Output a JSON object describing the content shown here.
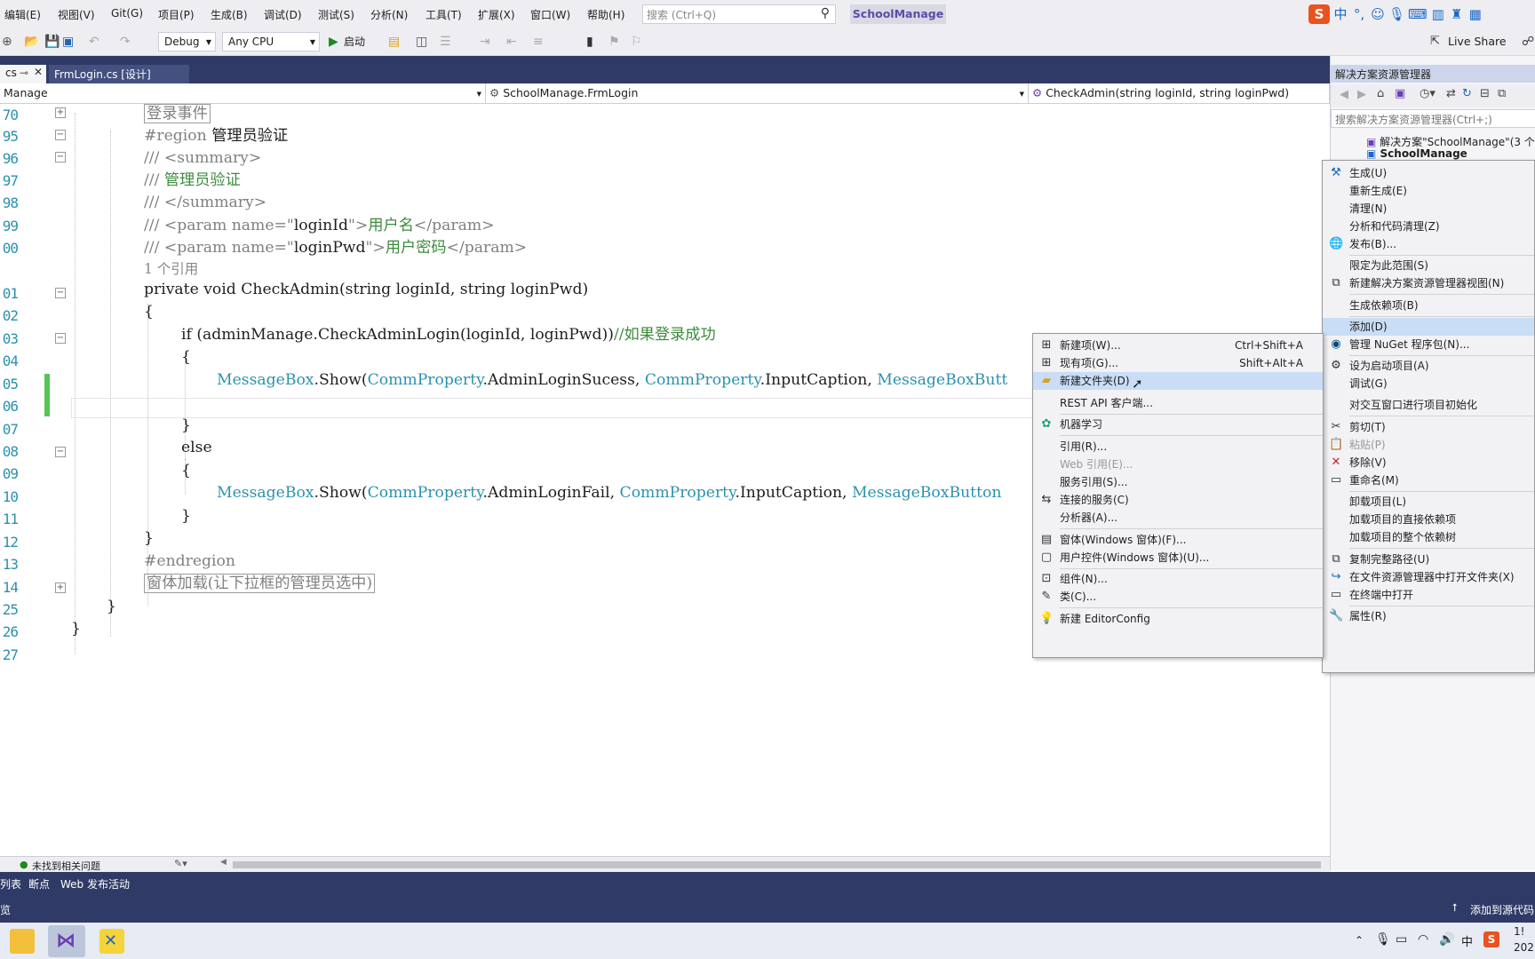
{
  "menus": [
    "编辑(E)",
    "视图(V)",
    "Git(G)",
    "项目(P)",
    "生成(B)",
    "调试(D)",
    "测试(S)",
    "分析(N)",
    "工具(T)",
    "扩展(X)",
    "窗口(W)",
    "帮助(H)"
  ],
  "search": {
    "placeholder": "搜索 (Ctrl+Q)"
  },
  "project_name": "SchoolManage",
  "ime": {
    "lang": "中",
    "punct": "°,"
  },
  "toolbar": {
    "config": "Debug",
    "platform": "Any CPU",
    "start": "启动",
    "live_share": "Live Share"
  },
  "tabs": {
    "prev": "cs",
    "active": "FrmLogin.cs [设计]"
  },
  "nav": {
    "project": "Manage",
    "class": "SchoolManage.FrmLogin",
    "member": "CheckAdmin(string loginId, string loginPwd)"
  },
  "line_numbers": [
    "70",
    "95",
    "96",
    "97",
    "98",
    "99",
    "00",
    "",
    "01",
    "02",
    "03",
    "04",
    "05",
    "06",
    "07",
    "08",
    "09",
    "10",
    "11",
    "12",
    "13",
    "14",
    "25",
    "26",
    "27"
  ],
  "code": {
    "region_collapsed": "登录事件",
    "region_kw": "#region",
    "region_name": "管理员验证",
    "doc1": "/// <summary>",
    "doc2_prefix": "/// ",
    "doc2": "管理员验证",
    "doc3": "/// </summary>",
    "doc4a": "/// <param name=\"",
    "doc4b": "loginId",
    "doc4c": "\">",
    "doc4d": "用户名",
    "doc4e": "</param>",
    "doc5b": "loginPwd",
    "doc5d": "用户密码",
    "refs": "1 个引用",
    "sig_a": "private void CheckAdmin(",
    "sig_b": "string",
    "sig_c": " loginId, ",
    "sig_d": " loginPwd)",
    "brace_open": "{",
    "brace_close": "}",
    "if_a": "if (adminManage.CheckAdminLogin(loginId, loginPwd))",
    "if_cmt": "//如果登录成功",
    "mb_a": "MessageBox",
    "mb_b": ".Show(",
    "mb_c": "CommProperty",
    "mb_d": ".AdminLoginSucess, ",
    "mb_e": ".InputCaption, ",
    "mb_f": "MessageBoxButt",
    "else_kw": "else",
    "mb2_d": ".AdminLoginFail, ",
    "mb2_f": "MessageBoxButton",
    "endregion": "#endregion",
    "region2": "窗体加载(让下拉框的管理员选中)"
  },
  "editor_status": {
    "issues": "未找到相关问题"
  },
  "solution": {
    "title": "解决方案资源管理器",
    "search_placeholder": "搜索解决方案资源管理器(Ctrl+;)",
    "root": "解决方案\"SchoolManage\"(3 个项目",
    "project": "SchoolManage"
  },
  "project_menu": [
    {
      "label": "生成(U)",
      "icon": "build-icon"
    },
    {
      "label": "重新生成(E)"
    },
    {
      "label": "清理(N)"
    },
    {
      "label": "分析和代码清理(Z)"
    },
    {
      "label": "发布(B)...",
      "icon": "publish-icon"
    },
    {
      "label": "限定为此范围(S)"
    },
    {
      "label": "新建解决方案资源管理器视图(N)",
      "icon": "new-view-icon"
    },
    {
      "label": "生成依赖项(B)"
    },
    {
      "label": "添加(D)"
    },
    {
      "label": "管理 NuGet 程序包(N)...",
      "icon": "nuget-icon"
    },
    {
      "label": "设为启动项目(A)",
      "icon": "gear-icon"
    },
    {
      "label": "调试(G)"
    },
    {
      "label": "对交互窗口进行项目初始化"
    },
    {
      "label": "剪切(T)",
      "icon": "cut-icon"
    },
    {
      "label": "粘贴(P)",
      "icon": "paste-icon",
      "disabled": true
    },
    {
      "label": "移除(V)",
      "icon": "remove-icon"
    },
    {
      "label": "重命名(M)",
      "icon": "rename-icon"
    },
    {
      "label": "卸载项目(L)"
    },
    {
      "label": "加载项目的直接依赖项"
    },
    {
      "label": "加载项目的整个依赖树"
    },
    {
      "label": "复制完整路径(U)",
      "icon": "copy-icon"
    },
    {
      "label": "在文件资源管理器中打开文件夹(X)",
      "icon": "open-folder-icon"
    },
    {
      "label": "在终端中打开",
      "icon": "terminal-icon"
    },
    {
      "label": "属性(R)",
      "icon": "wrench-icon"
    }
  ],
  "add_menu": [
    {
      "label": "新建项(W)...",
      "shortcut": "Ctrl+Shift+A",
      "icon": "new-item-icon"
    },
    {
      "label": "现有项(G)...",
      "shortcut": "Shift+Alt+A",
      "icon": "existing-item-icon"
    },
    {
      "label": "新建文件夹(D)",
      "icon": "folder-icon"
    },
    {
      "label": "REST API 客户端..."
    },
    {
      "label": "机器学习",
      "icon": "ml-icon"
    },
    {
      "label": "引用(R)..."
    },
    {
      "label": "Web 引用(E)...",
      "disabled": true
    },
    {
      "label": "服务引用(S)..."
    },
    {
      "label": "连接的服务(C)",
      "icon": "connected-service-icon"
    },
    {
      "label": "分析器(A)..."
    },
    {
      "label": "窗体(Windows 窗体)(F)...",
      "icon": "form-icon"
    },
    {
      "label": "用户控件(Windows 窗体)(U)...",
      "icon": "user-control-icon"
    },
    {
      "label": "组件(N)...",
      "icon": "component-icon"
    },
    {
      "label": "类(C)...",
      "icon": "class-icon"
    },
    {
      "label": "新建 EditorConfig",
      "icon": "lightbulb-icon"
    }
  ],
  "bottom_tabs": [
    "列表",
    "断点",
    "Web 发布活动"
  ],
  "statusbar": {
    "left": "览",
    "right": "添加到源代码"
  },
  "taskbar": {
    "ime": "中",
    "time": "1!",
    "date": "202"
  }
}
